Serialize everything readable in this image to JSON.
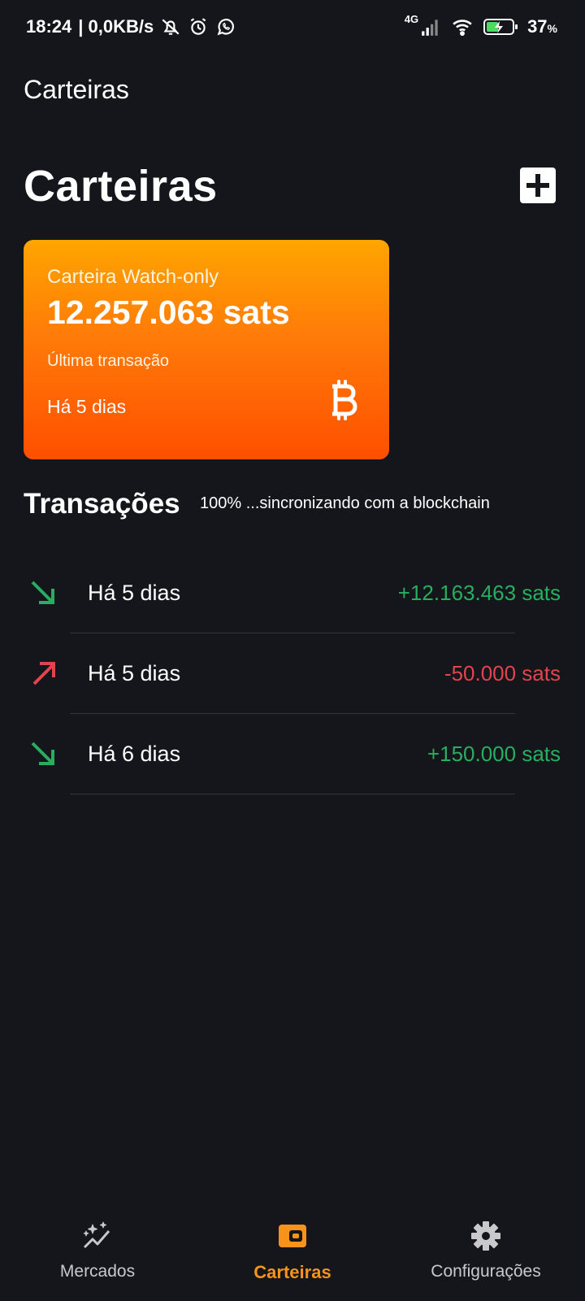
{
  "status_bar": {
    "time": "18:24",
    "speed": "| 0,0KB/s",
    "network": "4G",
    "battery": "37",
    "battery_unit": "%"
  },
  "app_bar": {
    "title": "Carteiras"
  },
  "header": {
    "title": "Carteiras"
  },
  "wallet": {
    "label": "Carteira Watch-only",
    "balance": "12.257.063 sats",
    "last_tx_label": "Última transação",
    "last_tx_value": "Há 5 dias"
  },
  "transactions": {
    "title": "Transações",
    "sync_status": "100% ...sincronizando com a blockchain",
    "items": [
      {
        "date": "Há 5 dias",
        "amount": "+12.163.463 sats",
        "direction": "in"
      },
      {
        "date": "Há 5 dias",
        "amount": "-50.000 sats",
        "direction": "out"
      },
      {
        "date": "Há 6 dias",
        "amount": "+150.000 sats",
        "direction": "in"
      }
    ]
  },
  "bottom_nav": {
    "items": [
      {
        "label": "Mercados",
        "icon": "sparkle-chart-icon"
      },
      {
        "label": "Carteiras",
        "icon": "wallet-icon",
        "active": true
      },
      {
        "label": "Configurações",
        "icon": "gear-icon"
      }
    ]
  },
  "colors": {
    "background": "#15161b",
    "accent": "#f7931a",
    "incoming": "#27ae60",
    "outgoing": "#e0444e"
  }
}
